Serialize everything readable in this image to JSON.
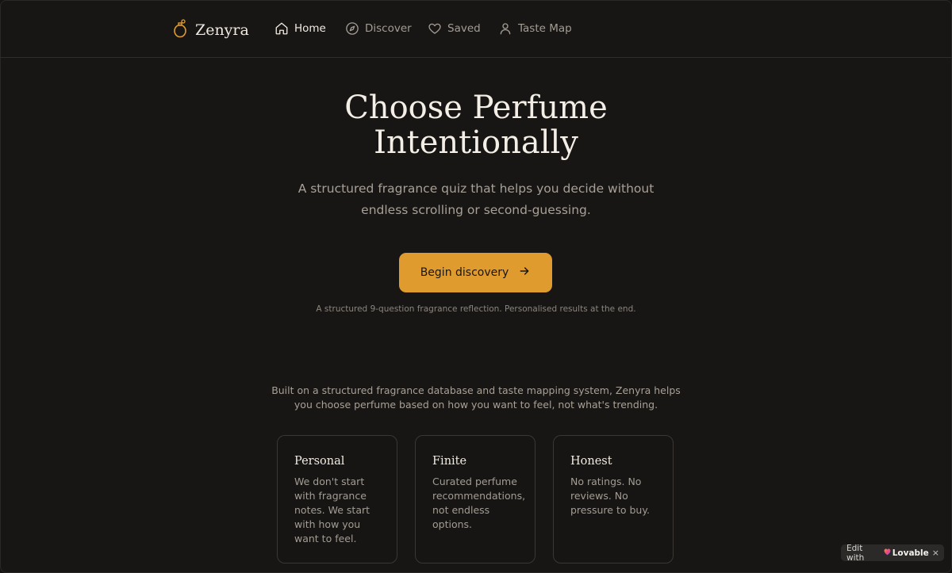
{
  "header": {
    "logo_text": "Zenyra",
    "logo_icon": "perfume-bottle-icon",
    "accent_color": "#e09b2f",
    "nav": [
      {
        "label": "Home",
        "icon": "home-icon",
        "active": true
      },
      {
        "label": "Discover",
        "icon": "compass-icon",
        "active": false
      },
      {
        "label": "Saved",
        "icon": "heart-icon",
        "active": false
      },
      {
        "label": "Taste Map",
        "icon": "user-icon",
        "active": false
      }
    ]
  },
  "hero": {
    "title_line1": "Choose Perfume",
    "title_line2": "Intentionally",
    "subtitle": "A structured fragrance quiz that helps you decide without endless scrolling or second-guessing.",
    "cta_label": "Begin discovery",
    "cta_note": "A structured 9-question fragrance reflection. Personalised results at the end."
  },
  "intro": "Built on a structured fragrance database and taste mapping system, Zenyra helps you choose perfume based on how you want to feel, not what's trending.",
  "cards": [
    {
      "title": "Personal",
      "text": "We don't start with fragrance notes. We start with how you want to feel."
    },
    {
      "title": "Finite",
      "text": "Curated perfume recommendations, not endless options."
    },
    {
      "title": "Honest",
      "text": "No ratings. No reviews. No pressure to buy."
    }
  ],
  "badge": {
    "prefix": "Edit with",
    "brand": "Lovable",
    "close": "×"
  }
}
